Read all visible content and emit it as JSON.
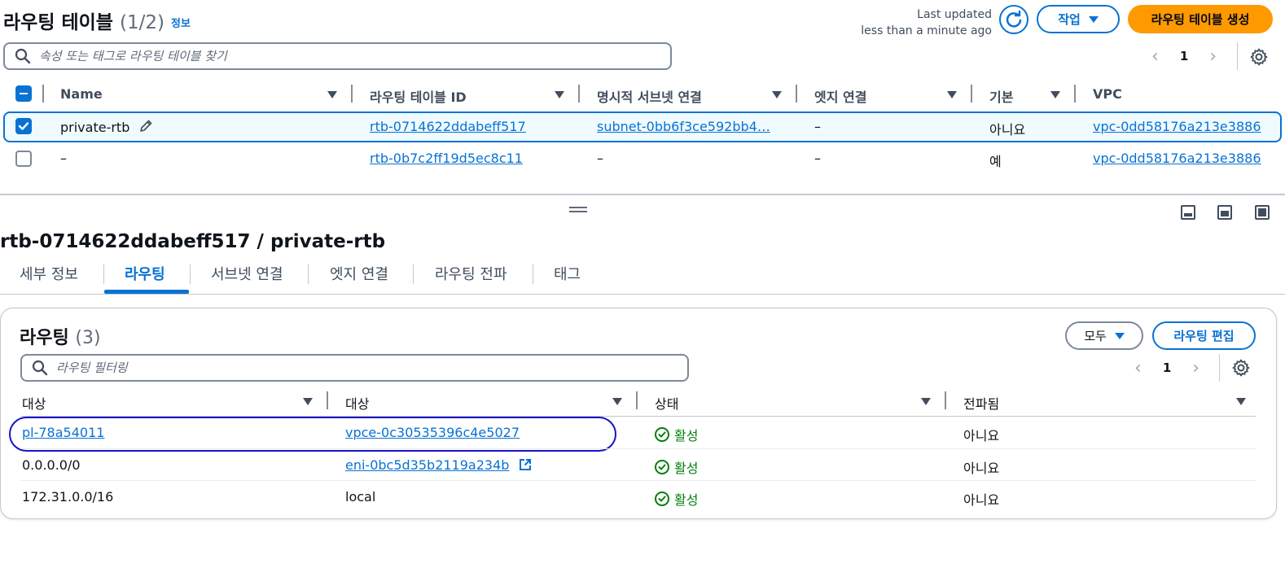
{
  "header": {
    "title": "라우팅 테이블",
    "count": "(1/2)",
    "info_link": "정보",
    "last_updated_line1": "Last updated",
    "last_updated_line2": "less than a minute ago",
    "actions_label": "작업",
    "create_label": "라우팅 테이블 생성",
    "refresh_icon": "refresh-icon"
  },
  "search": {
    "placeholder": "속성 또는 태그로 라우팅 테이블 찾기"
  },
  "pagination": {
    "page": "1"
  },
  "table": {
    "columns": [
      "Name",
      "라우팅 테이블 ID",
      "명시적 서브넷 연결",
      "엣지 연결",
      "기본",
      "VPC"
    ],
    "rows": [
      {
        "selected": true,
        "name": "private-rtb",
        "id": "rtb-0714622ddabeff517",
        "subnet": "subnet-0bb6f3ce592bb4…",
        "edge": "–",
        "main": "아니요",
        "vpc": "vpc-0dd58176a213e3886"
      },
      {
        "selected": false,
        "name": "–",
        "id": "rtb-0b7c2ff19d5ec8c11",
        "subnet": "–",
        "edge": "–",
        "main": "예",
        "vpc": "vpc-0dd58176a213e3886"
      }
    ]
  },
  "detail": {
    "title": "rtb-0714622ddabeff517 / private-rtb",
    "tabs": [
      "세부 정보",
      "라우팅",
      "서브넷 연결",
      "엣지 연결",
      "라우팅 전파",
      "태그"
    ],
    "active_tab": "라우팅"
  },
  "routes": {
    "title": "라우팅",
    "count": "(3)",
    "filter_label": "모두",
    "edit_label": "라우팅 편집",
    "search_placeholder": "라우팅 필터링",
    "page": "1",
    "columns": [
      "대상",
      "대상",
      "상태",
      "전파됨"
    ],
    "rows": [
      {
        "destination": "pl-78a54011",
        "target": "vpce-0c30535396c4e5027",
        "status": "활성",
        "propagated": "아니요"
      },
      {
        "destination": "0.0.0.0/0",
        "target": "eni-0bc5d35b2119a234b",
        "status": "활성",
        "propagated": "아니요"
      },
      {
        "destination": "172.31.0.0/16",
        "target": "local",
        "status": "활성",
        "propagated": "아니요"
      }
    ]
  },
  "colors": {
    "accent": "#0972d3",
    "primary_button": "#ff9900",
    "success": "#037f0c",
    "highlight_oval": "#1a12c8"
  }
}
